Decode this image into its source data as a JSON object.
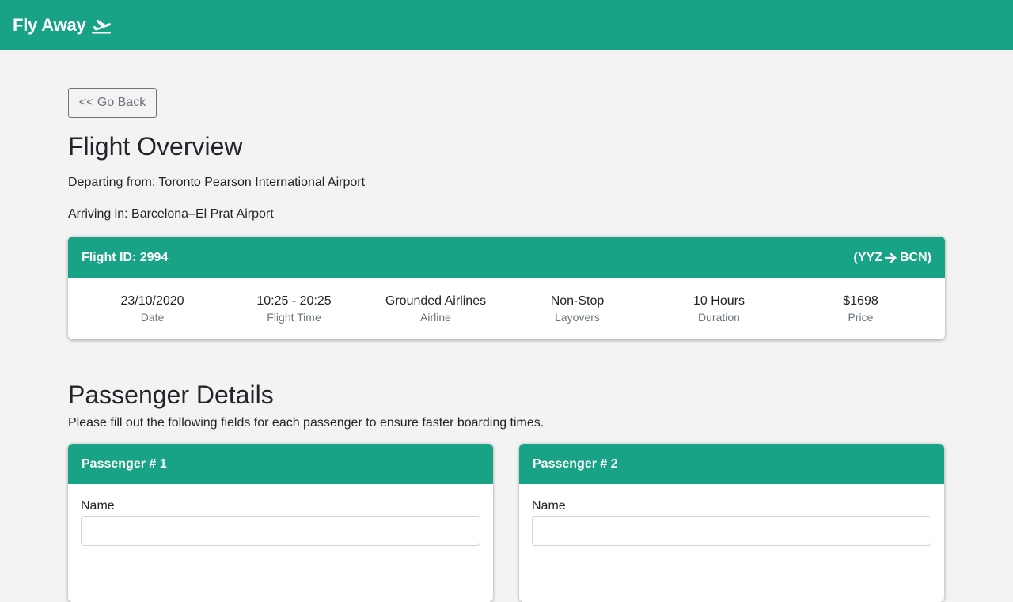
{
  "navbar": {
    "brand": "Fly Away",
    "brand_icon": "plane-departure-icon"
  },
  "page": {
    "back_label": "<< Go Back",
    "title": "Flight Overview",
    "departing": "Departing from: Toronto Pearson International Airport",
    "arriving": "Arriving in: Barcelona–El Prat Airport"
  },
  "flight": {
    "id_label": "Flight ID: 2994",
    "route_open": "(YYZ",
    "route_close": "BCN)",
    "route_icon": "arrow-right-icon",
    "stats": [
      {
        "value": "23/10/2020",
        "label": "Date"
      },
      {
        "value": "10:25 - 20:25",
        "label": "Flight Time"
      },
      {
        "value": "Grounded Airlines",
        "label": "Airline"
      },
      {
        "value": "Non-Stop",
        "label": "Layovers"
      },
      {
        "value": "10 Hours",
        "label": "Duration"
      },
      {
        "value": "$1698",
        "label": "Price"
      }
    ]
  },
  "passengers": {
    "title": "Passenger Details",
    "subtitle": "Please fill out the following fields for each passenger to ensure faster boarding times.",
    "cards": [
      {
        "title": "Passenger # 1",
        "name_label": "Name",
        "name_value": ""
      },
      {
        "title": "Passenger # 2",
        "name_label": "Name",
        "name_value": ""
      }
    ]
  },
  "colors": {
    "accent": "#18a386",
    "background": "#f3f3f3",
    "muted": "#6c757d"
  }
}
